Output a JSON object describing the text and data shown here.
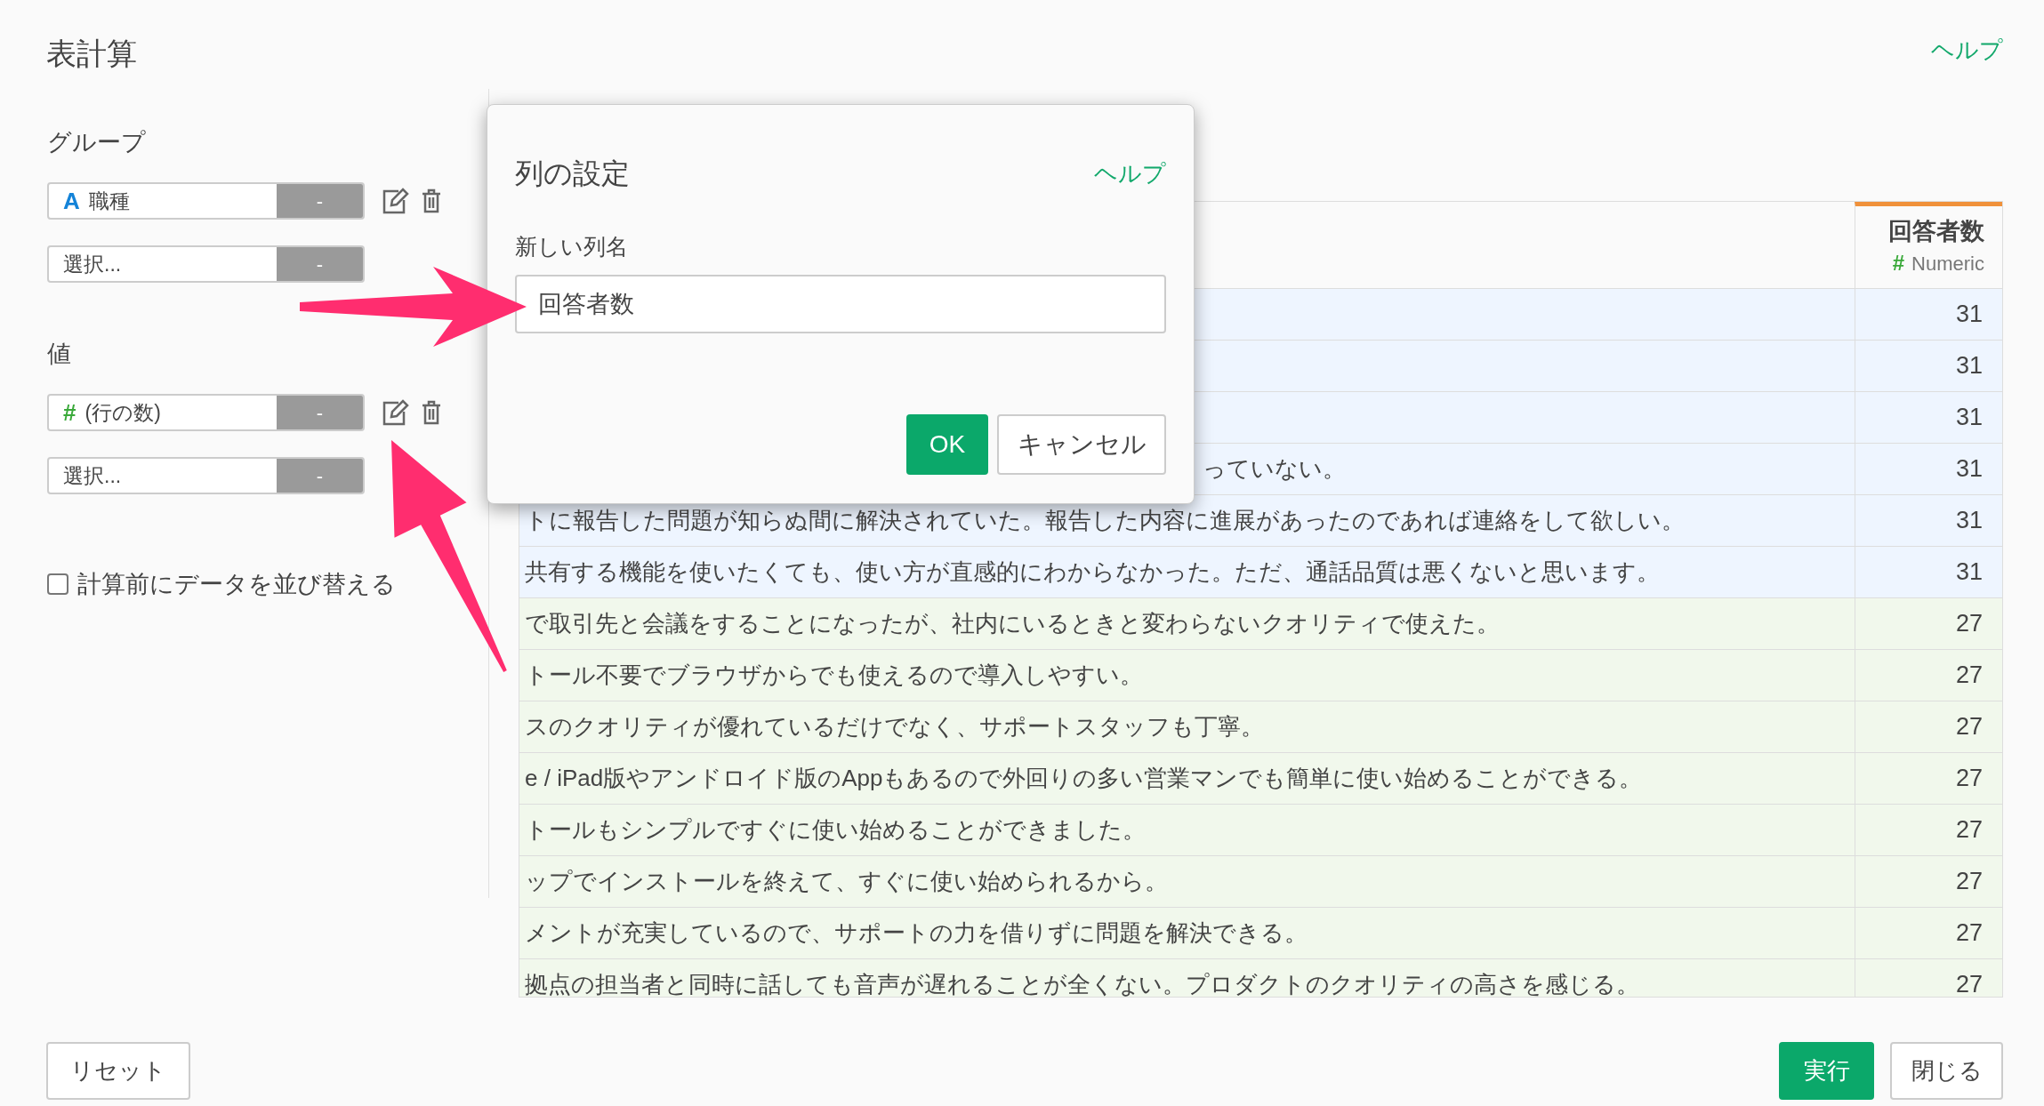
{
  "title": "表計算",
  "help_link": "ヘルプ",
  "group": {
    "label": "グループ",
    "fields": [
      {
        "kind": "string",
        "icon": "A",
        "value": "職種",
        "button": "-"
      },
      {
        "kind": "empty",
        "placeholder": "選択...",
        "button": "-"
      }
    ]
  },
  "values": {
    "label": "値",
    "fields": [
      {
        "kind": "numeric",
        "icon": "#",
        "value": "(行の数)",
        "button": "-"
      },
      {
        "kind": "empty",
        "placeholder": "選択...",
        "button": "-"
      }
    ]
  },
  "sort_checkbox": {
    "label": "計算前にデータを並び替える",
    "checked": false
  },
  "table": {
    "numeric_column": {
      "name": "回答者数",
      "type_icon": "#",
      "type_label": "Numeric"
    },
    "rows": [
      {
        "count": "31",
        "color": "#eef5ff"
      },
      {
        "count": "31",
        "color": "#eef5ff"
      },
      {
        "count": "31",
        "color": "#eef5ff"
      },
      {
        "text": "っていない。",
        "count": "31",
        "color": "#eef5ff"
      },
      {
        "text": "トに報告した問題が知らぬ間に解決されていた。報告した内容に進展があったのであれば連絡をして欲しい。",
        "count": "31",
        "color": "#eef5ff"
      },
      {
        "text": "共有する機能を使いたくても、使い方が直感的にわからなかった。ただ、通話品質は悪くないと思います。",
        "count": "31",
        "color": "#eef5ff"
      },
      {
        "text": "で取引先と会議をすることになったが、社内にいるときと変わらないクオリティで使えた。",
        "count": "27",
        "color": "#f1f8ec"
      },
      {
        "text": "トール不要でブラウザからでも使えるので導入しやすい。",
        "count": "27",
        "color": "#f1f8ec"
      },
      {
        "text": "スのクオリティが優れているだけでなく、サポートスタッフも丁寧。",
        "count": "27",
        "color": "#f1f8ec"
      },
      {
        "text": "e / iPad版やアンドロイド版のAppもあるので外回りの多い営業マンでも簡単に使い始めることができる。",
        "count": "27",
        "color": "#f1f8ec"
      },
      {
        "text": "トールもシンプルですぐに使い始めることができました。",
        "count": "27",
        "color": "#f1f8ec"
      },
      {
        "text": "ップでインストールを終えて、すぐに使い始められるから。",
        "count": "27",
        "color": "#f1f8ec"
      },
      {
        "text": "メントが充実しているので、サポートの力を借りずに問題を解決できる。",
        "count": "27",
        "color": "#f1f8ec"
      },
      {
        "text": "拠点の担当者と同時に話しても音声が遅れることが全くない。プロダクトのクオリティの高さを感じる。",
        "count": "27",
        "color": "#f1f8ec"
      }
    ]
  },
  "dialog": {
    "title": "列の設定",
    "help_link": "ヘルプ",
    "field_label": "新しい列名",
    "value": "回答者数",
    "ok": "OK",
    "cancel": "キャンセル"
  },
  "footer": {
    "reset": "リセット",
    "run": "実行",
    "close": "閉じる"
  }
}
